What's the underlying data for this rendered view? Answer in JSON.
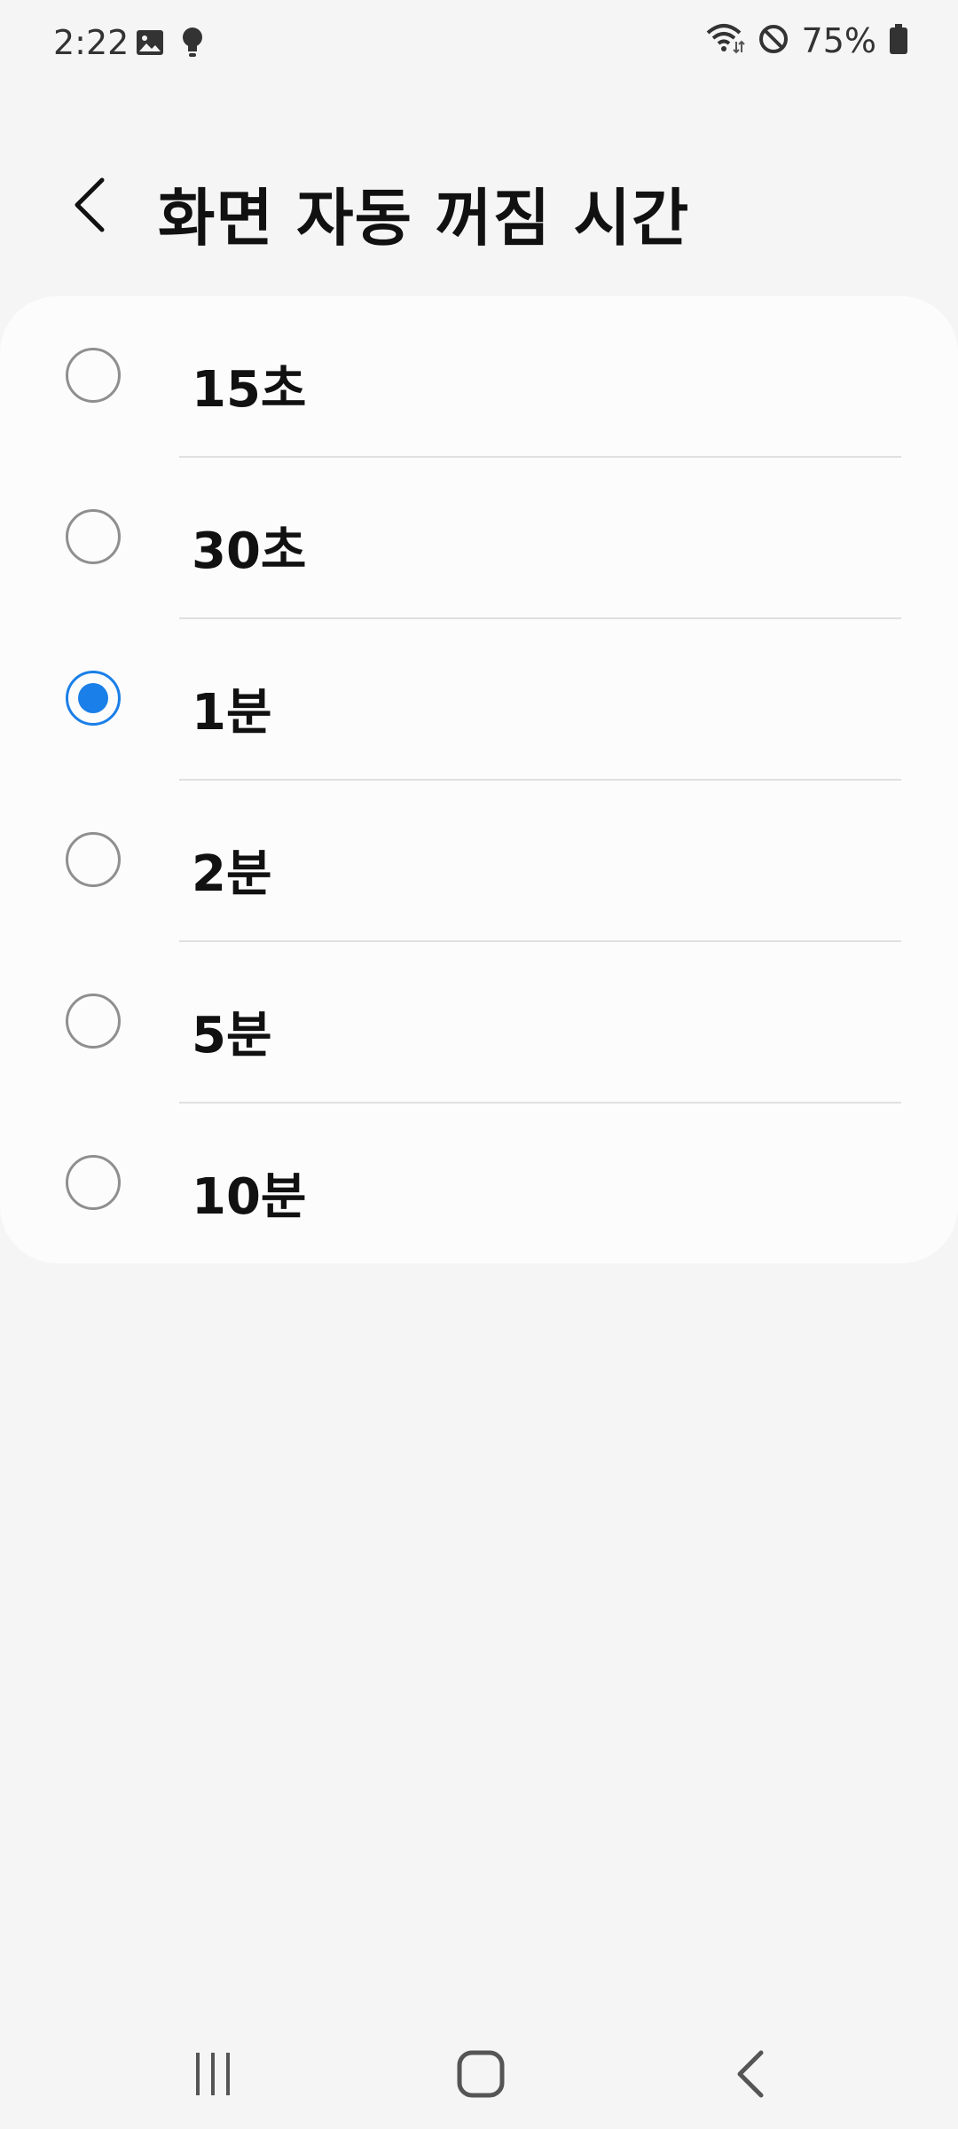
{
  "status_bar": {
    "time": "2:22",
    "battery_text": "75%",
    "icons": [
      "image-icon",
      "lightbulb-icon",
      "wifi-icon",
      "do-not-disturb-icon",
      "battery-icon"
    ]
  },
  "header": {
    "title": "화면 자동 꺼짐 시간",
    "back_icon": "chevron-left-icon"
  },
  "options": [
    {
      "label": "15초",
      "selected": false
    },
    {
      "label": "30초",
      "selected": false
    },
    {
      "label": "1분",
      "selected": true
    },
    {
      "label": "2분",
      "selected": false
    },
    {
      "label": "5분",
      "selected": false
    },
    {
      "label": "10분",
      "selected": false
    }
  ],
  "nav_bar": {
    "icons": [
      "recents-icon",
      "home-icon",
      "back-icon"
    ]
  },
  "colors": {
    "accent": "#1a7fe8",
    "background": "#f5f5f5",
    "card": "#fcfcfc"
  }
}
